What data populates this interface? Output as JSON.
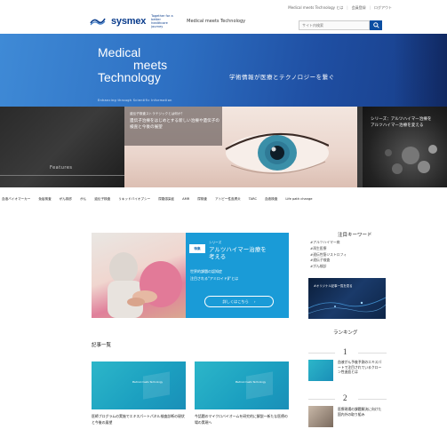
{
  "header": {
    "top_links": [
      "Medical meets Technology とは",
      "会員登録",
      "ログアウト"
    ],
    "logo_text": "sysmex",
    "logo_tagline": "Together for a better healthcare journey",
    "site_name": "Medical meets Technology",
    "search_placeholder": "サイト内検索"
  },
  "hero": {
    "title_line1": "Medical",
    "title_line2": "meets",
    "title_line3": "Technology",
    "subtitle": "Enhancing through Scientific Information",
    "catch": "学術情報が医療とテクノロジーを繋ぐ"
  },
  "carousel": {
    "left_label": "Features",
    "main_kicker": "遺伝子検査ストラテジックとは何か？",
    "main_title": "遺伝子治療をはじめとする新しい治療や遺伝子の検査と今後の展望",
    "right_title": "シリーズ：アルツハイマー治療を\nアルツハイマー治療を変える"
  },
  "keyword_nav": [
    "血液バイオマーカー",
    "免疫検査",
    "がん検診",
    "がん",
    "遺伝子検査",
    "リキッドバイオプシー",
    "尿路感染症",
    "AMR",
    "尿検査",
    "アトピー性皮膚炎",
    "TARC",
    "血液検査",
    "Life path change"
  ],
  "feature": {
    "badge": "特集",
    "series": "シリーズ",
    "title_line1": "アルツハイマー治療を",
    "title_line2": "考える",
    "sub1": "世界的課題の認知症",
    "sub2": "注目される\"アミロイドβ\"とは",
    "more_label": "詳しくはこちら",
    "more_arrow": "›"
  },
  "attention": {
    "heading": "注目キーワード",
    "keywords": [
      "アルツハイマー病",
      "再生医療",
      "遺伝性筋ジストロフィ",
      "遺伝子検査",
      "がん検診"
    ]
  },
  "original": {
    "title": "#オリジナル記事一覧を見る"
  },
  "ranking": {
    "heading": "ランキング",
    "items": [
      {
        "num": "1",
        "text": "血液がん予後予測のエキスパートで注目されているクローン性造血とは"
      },
      {
        "num": "2",
        "text": "医療現場の課題解決に向けた国内外の取り組み"
      }
    ]
  },
  "articles": {
    "heading": "記事一覧",
    "items": [
      {
        "tag": "Medical meets Technology",
        "text": "医師プログラムの実施でエキスパートパネル検査診断の現状と今後の展望"
      },
      {
        "tag": "Medical meets Technology",
        "text": "今話題のマイクロバイオームを研究的に解説ー新たな医療の場の実現へ"
      }
    ]
  },
  "colors": {
    "brand_blue": "#0b4ea2",
    "hero_blue": "#2d6fc2",
    "feature_blue": "#1a9bd7"
  }
}
